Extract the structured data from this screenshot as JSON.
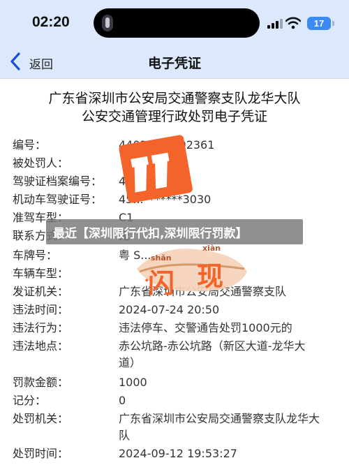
{
  "status_bar": {
    "time": "02:20",
    "battery": "17"
  },
  "nav": {
    "back_label": "返回",
    "title": "电子凭证"
  },
  "document": {
    "title_line1": "广东省深圳市公安局交通警察支队龙华大队",
    "title_line2": "公安交通管理行政处罚电子凭证",
    "rows": [
      {
        "label": "编号：",
        "value": "4403...00202361"
      },
      {
        "label": "被处罚人：",
        "value": ""
      },
      {
        "label": "驾驶证档案编号：",
        "value": "4...94"
      },
      {
        "label": "机动车驾驶证号：",
        "value": "45...*******3030"
      },
      {
        "label": "准驾车型：",
        "value": "C1"
      },
      {
        "label": "联系方式：",
        "value": "无"
      },
      {
        "label": "车牌号：",
        "value": "粤 S..."
      },
      {
        "label": "车辆车型：",
        "value": ""
      },
      {
        "label": "发证机关：",
        "value": "广东省深圳市公安局交通警察支队"
      },
      {
        "label": "违法时间：",
        "value": "2024-07-24 20:50"
      },
      {
        "label": "违法行为：",
        "value": "违法停车、交警通告处罚1000元的"
      },
      {
        "label": "违法地点：",
        "value": "赤公坑路-赤公坑路（新区大道-龙华大道）"
      },
      {
        "label": "罚款金额：",
        "value": "1000"
      },
      {
        "label": "记分：",
        "value": "0"
      },
      {
        "label": "处罚机关：",
        "value": "广东省深圳市公安局交通警察支队龙华大队"
      },
      {
        "label": "处罚时间：",
        "value": "2024-09-12 19:53:27"
      }
    ]
  },
  "banner": {
    "text": "最近【深圳限行代扣,深圳限行罚款】"
  },
  "watermark": {
    "word_pinyin_1": "shǎn",
    "word_pinyin_2": "xiàn",
    "word_char_1": "闪",
    "word_char_2": "现"
  },
  "colors": {
    "header_bg": "#dce8fb",
    "logo_orange": "#f4642a",
    "battery_blue": "#3c8af0"
  }
}
